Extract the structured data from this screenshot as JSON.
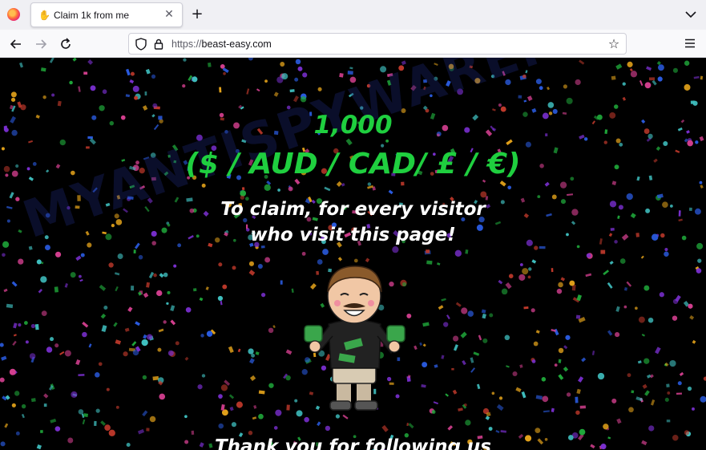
{
  "browser": {
    "tab": {
      "title": "Claim 1k from me",
      "favicon": "waving-hand-icon"
    },
    "url": {
      "protocol": "https://",
      "host": "beast-easy.com"
    }
  },
  "page": {
    "amount_line1": "1,000",
    "amount_line2": "($ / AUD / CAD/ £ / €)",
    "subtitle_line1": "To claim, for every visitor",
    "subtitle_line2": "who visit this page!",
    "footer_partial": "Thank you for following us",
    "watermark": "MYANTISPYWARE.COM",
    "mascot": "cartoon-man-holding-cash"
  },
  "colors": {
    "background": "#000000",
    "amount": "#1fcf3f",
    "confetti": [
      "#7a2fd0",
      "#1fa83a",
      "#d43f8f",
      "#2a5be0",
      "#e3a21a",
      "#c0392b",
      "#3fbfbf"
    ]
  }
}
